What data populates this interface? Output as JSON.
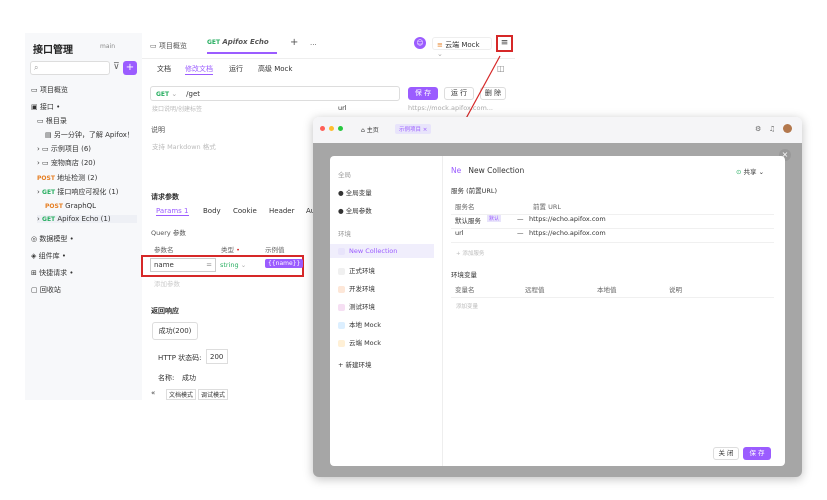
{
  "sidebar": {
    "title": "接口管理",
    "branch": "main",
    "search_placeholder": "",
    "items": [
      {
        "label": "项目概览"
      },
      {
        "label": "接口 •"
      },
      {
        "label": "根目录"
      },
      {
        "label": "另一分钟，了解 Apifox！"
      },
      {
        "label": "示例项目 (6)"
      },
      {
        "label": "宠物商店 (20)"
      },
      {
        "method": "POST",
        "label": "地址检测 (2)"
      },
      {
        "method": "GET",
        "label": "接口响应可视化 (1)"
      },
      {
        "method": "POST",
        "label": "GraphQL"
      },
      {
        "method": "GET",
        "label": "Apifox Echo (1)"
      },
      {
        "label": "数据模型 •"
      },
      {
        "label": "组件库 •"
      },
      {
        "label": "快捷请求 •"
      },
      {
        "label": "回收站"
      }
    ]
  },
  "tabs": {
    "overview": "项目概览",
    "method": "GET",
    "active": "Apifox Echo",
    "plus": "+",
    "more": "···"
  },
  "env": {
    "selector": "云端 Mock"
  },
  "subtabs": [
    "文档",
    "修改文档",
    "运行",
    "高级 Mock"
  ],
  "request": {
    "method": "GET",
    "path": "/get",
    "save": "保 存",
    "run": "运 行",
    "delete": "删 除",
    "desc_placeholder": "接口说明/创建标签",
    "url_label": "url",
    "url_value": "https://mock.apifox.com..."
  },
  "desc": {
    "label": "说明",
    "placeholder": "支持 Markdown 格式"
  },
  "params": {
    "title": "请求参数",
    "tabs": [
      "Params 1",
      "Body",
      "Cookie",
      "Header",
      "Au"
    ],
    "query": "Query 参数",
    "headers": [
      "参数名",
      "类型",
      "示例值"
    ],
    "row": {
      "name": "name",
      "eq": "=",
      "type": "string",
      "example": "{{name}}"
    },
    "add": "添加参数"
  },
  "response": {
    "title": "返回响应",
    "tab": "成功(200)",
    "status_label": "HTTP 状态码:",
    "status": "200",
    "name_label": "名称:",
    "name": "成功"
  },
  "footer": {
    "doc": "文档模式",
    "debug": "调试模式"
  },
  "overlay": {
    "home": "主页",
    "tab": "示例项目 ×"
  },
  "envpanel": {
    "global": "全局",
    "global_vars": "全局变量",
    "global_params": "全局参数",
    "env_header": "环境",
    "envs": [
      "New Collection",
      "正式环境",
      "开发环境",
      "测试环境",
      "本地 Mock",
      "云端 Mock"
    ],
    "new_env": "+ 新建环境",
    "name_prefix": "Ne",
    "name": "New Collection",
    "share": "共享",
    "services_title": "服务 (前置URL)",
    "svc_headers": [
      "服务名",
      "前置 URL"
    ],
    "services": [
      {
        "name": "默认服务",
        "badge": "默认",
        "url": "https://echo.apifox.com"
      },
      {
        "name": "url",
        "url": "https://echo.apifox.com"
      }
    ],
    "add_service": "+ 添加服务",
    "vars_title": "环境变量",
    "var_headers": [
      "变量名",
      "远程值",
      "本地值",
      "说明"
    ],
    "add_var": "添加变量",
    "close": "关 闭",
    "save": "保 存"
  },
  "colors": {
    "accent": "#9b5cff",
    "red": "#d62828"
  }
}
